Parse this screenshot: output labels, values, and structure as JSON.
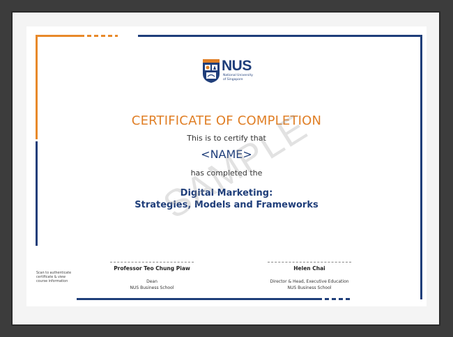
{
  "certificate": {
    "logo": {
      "name": "NUS",
      "subtitle_line1": "National University",
      "subtitle_line2": "of Singapore"
    },
    "title": "CERTIFICATE OF COMPLETION",
    "certify_text": "This is to certify that",
    "recipient": "<NAME>",
    "completed_text": "has completed the",
    "course_line1": "Digital Marketing:",
    "course_line2": "Strategies, Models and Frameworks",
    "watermark": "SAMPLE",
    "scan_note_line1": "Scan to authenticate",
    "scan_note_line2": "certificate & view",
    "scan_note_line3": "course information",
    "signatories": [
      {
        "name": "Professor Teo Chung Piaw",
        "role_line1": "Dean",
        "role_line2": "NUS Business School"
      },
      {
        "name": "Helen Chai",
        "role_line1": "Director & Head, Executive Education",
        "role_line2": "NUS Business School"
      }
    ]
  },
  "colors": {
    "accent_orange": "#e07f26",
    "accent_navy": "#1f3e7a"
  }
}
